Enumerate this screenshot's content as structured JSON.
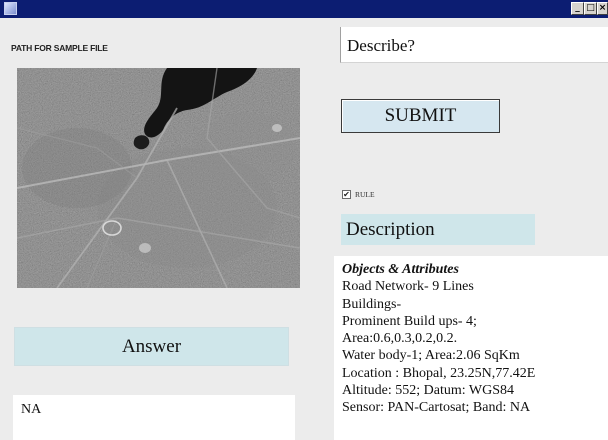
{
  "window": {
    "title": "",
    "icon": "java-app-icon",
    "controls": [
      "minimize",
      "maximize",
      "close"
    ]
  },
  "path_label": "PATH FOR SAMPLE FILE",
  "image": {
    "icon": "satellite-image"
  },
  "describe_field": {
    "value": "Describe?"
  },
  "submit_button": {
    "label": "SUBMIT"
  },
  "rule_checkbox": {
    "label": "RULE",
    "checked": true
  },
  "description": {
    "label": "Description",
    "heading": "Objects & Attributes",
    "lines": [
      "Road Network- 9 Lines",
      "Buildings-",
      "Prominent Build ups- 4;",
      "Area:0.6,0.3,0.2,0.2.",
      "Water body-1; Area:2.06 SqKm",
      "Location : Bhopal, 23.25N,77.42E",
      "Altitude: 552; Datum: WGS84",
      "Sensor: PAN-Cartosat; Band: NA"
    ]
  },
  "answer": {
    "label": "Answer",
    "value": "NA"
  },
  "colors": {
    "titlebar": "#0c1d72",
    "label_panel": "#cfe6ea",
    "button": "#d6e7f0",
    "background": "#ececec"
  }
}
